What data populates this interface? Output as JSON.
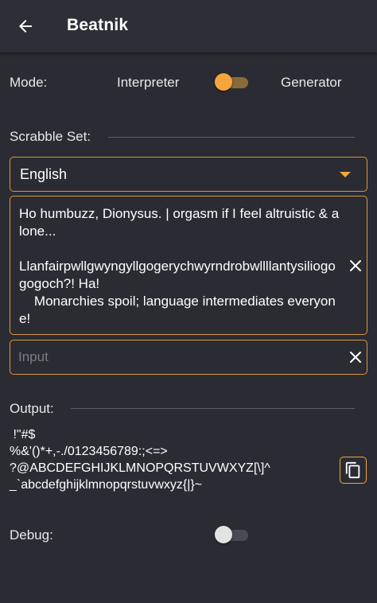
{
  "appbar": {
    "title": "Beatnik",
    "back_icon": "arrow-left-icon"
  },
  "mode": {
    "label": "Mode:",
    "option_left": "Interpreter",
    "option_right": "Generator",
    "toggle_on": true
  },
  "scrabble": {
    "label": "Scrabble Set:",
    "selected": "English"
  },
  "source": {
    "text": "Ho humbuzz, Dionysus. | orgasm if I feel altruistic & alone...\n\nLlanfairpwllgwyngyllgogerychwyrndrobwllllantysiliogogogoch?! Ha!\n    Monarchies spoil; language intermediates everyone!"
  },
  "input": {
    "value": "",
    "placeholder": "Input"
  },
  "output": {
    "label": "Output:",
    "text": " !\"#$\n%&'()*+,-./0123456789:;<=>\n?@ABCDEFGHIJKLMNOPQRSTUVWXYZ[\\]^\n_`abcdefghijklmnopqrstuvwxyz{|}~"
  },
  "debug": {
    "label": "Debug:",
    "toggle_on": false
  },
  "colors": {
    "background": "#2b2c33",
    "appbar": "#2e2f36",
    "accent": "#f5a53a",
    "divider": "#5d5e65",
    "text": "#ffffff"
  }
}
